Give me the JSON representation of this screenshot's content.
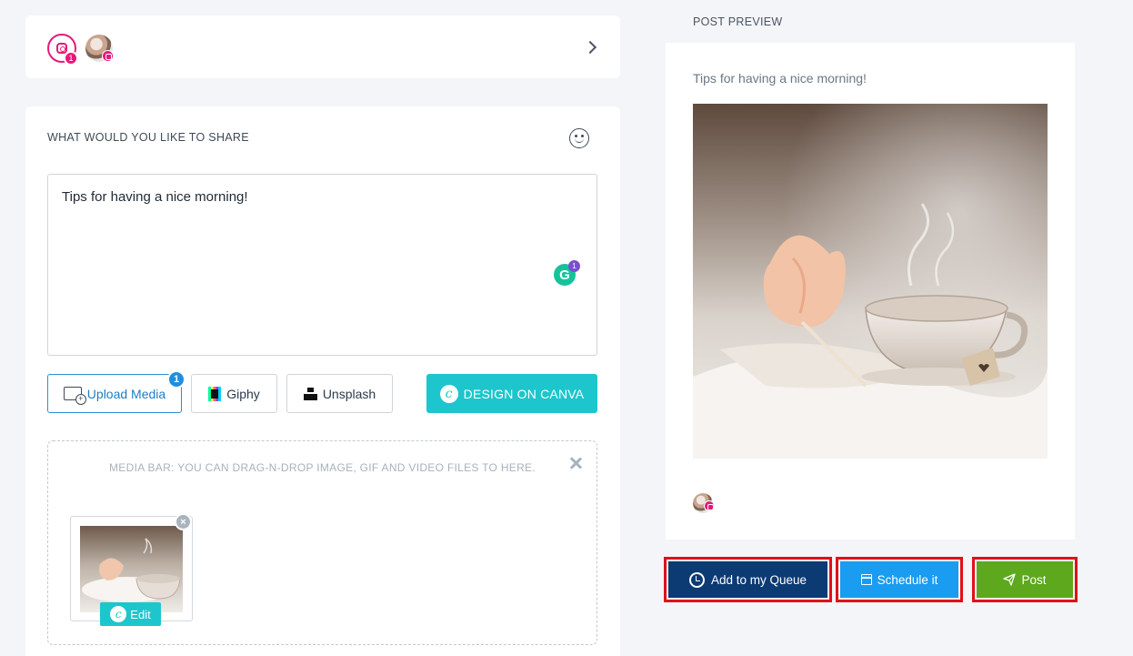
{
  "account": {
    "network_count": "1"
  },
  "compose": {
    "section_label": "WHAT WOULD YOU LIKE TO SHARE",
    "text": "Tips for having a nice morning!",
    "grammarly_count": "1",
    "buttons": {
      "upload_label": "Upload Media",
      "upload_badge": "1",
      "giphy_label": "Giphy",
      "unsplash_label": "Unsplash",
      "canva_label": "DESIGN ON CANVA"
    },
    "media_bar": {
      "hint": "MEDIA BAR: YOU CAN DRAG-N-DROP IMAGE, GIF AND VIDEO FILES TO HERE.",
      "edit_label": "Edit"
    }
  },
  "preview": {
    "section_label": "POST PREVIEW",
    "text": "Tips for having a nice morning!"
  },
  "actions": {
    "queue_label": "Add to my Queue",
    "schedule_label": "Schedule it",
    "post_label": "Post"
  },
  "colors": {
    "instagram": "#e6197a",
    "canva": "#1cc6cc",
    "queue": "#0c3b74",
    "schedule": "#1a9cf0",
    "post": "#5da81c",
    "highlight_border": "#e0101a"
  },
  "icons": [
    "instagram-icon",
    "chevron-right-icon",
    "emoji-icon",
    "grammarly-icon",
    "image-upload-icon",
    "giphy-icon",
    "unsplash-icon",
    "canva-icon",
    "close-icon",
    "remove-icon",
    "queue-icon",
    "calendar-icon",
    "send-icon"
  ]
}
